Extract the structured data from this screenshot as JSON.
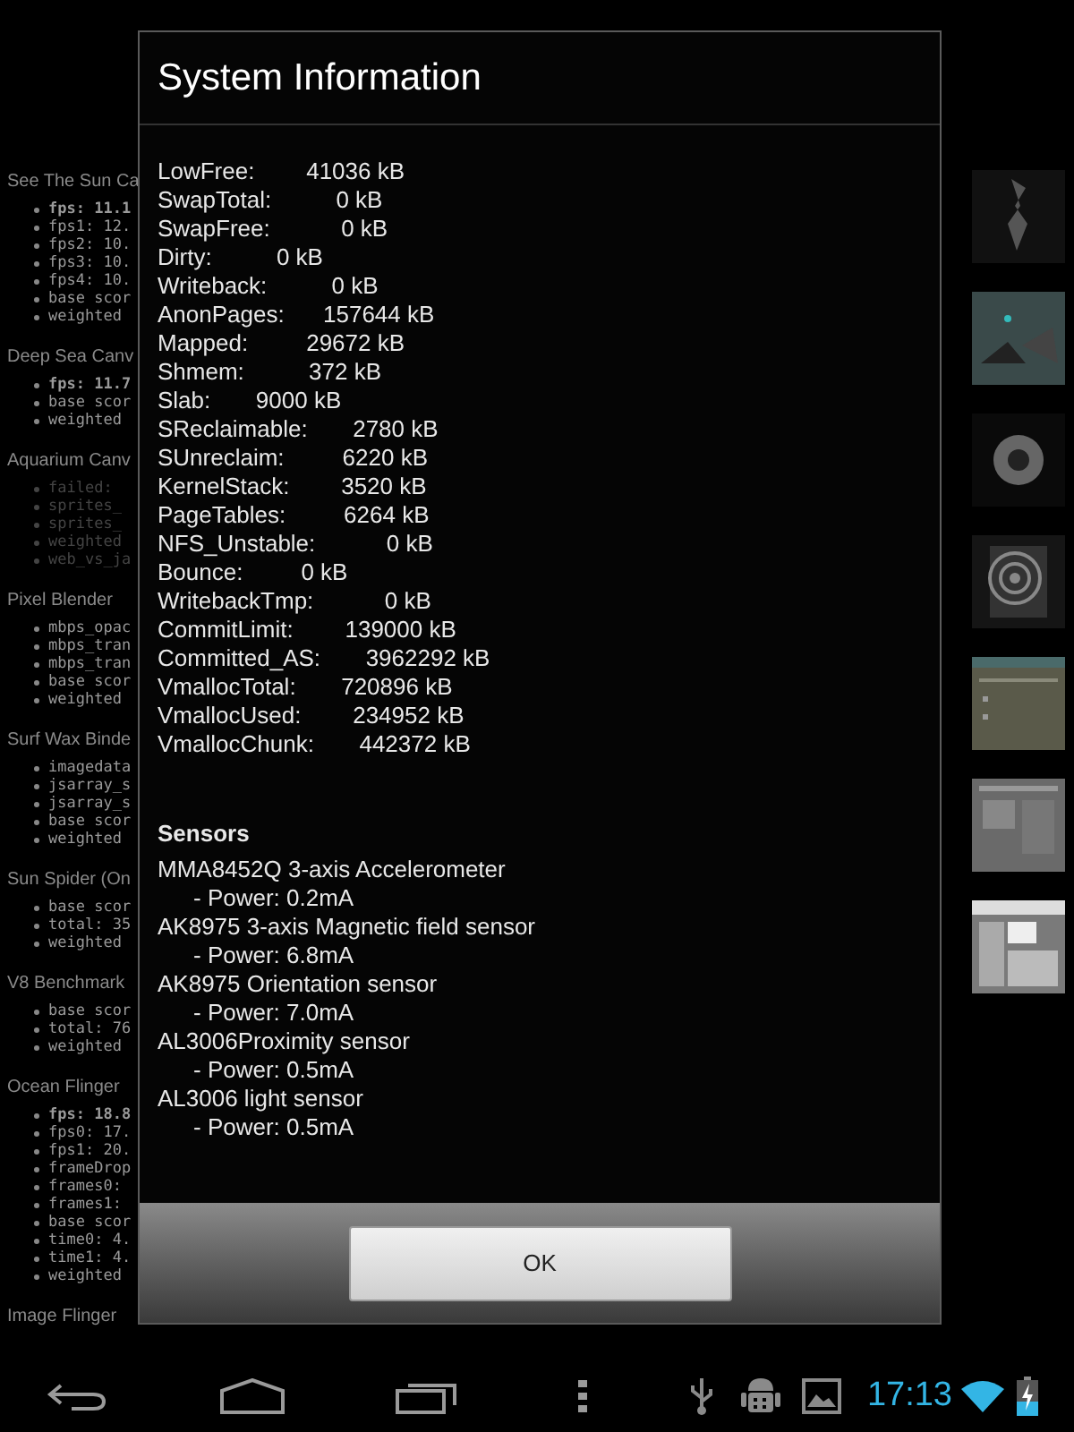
{
  "background": {
    "sections": [
      {
        "title": "See The Sun Ca",
        "items": [
          {
            "text": "fps: 11.1",
            "emphasized": true,
            "disabled": false
          },
          {
            "text": "fps1: 12.",
            "emphasized": false,
            "disabled": false
          },
          {
            "text": "fps2: 10.",
            "emphasized": false,
            "disabled": false
          },
          {
            "text": "fps3: 10.",
            "emphasized": false,
            "disabled": false
          },
          {
            "text": "fps4: 10.",
            "emphasized": false,
            "disabled": false
          },
          {
            "text": "base scor",
            "emphasized": false,
            "disabled": false
          },
          {
            "text": "weighted",
            "emphasized": false,
            "disabled": false
          }
        ]
      },
      {
        "title": "Deep Sea Canv",
        "items": [
          {
            "text": "fps: 11.7",
            "emphasized": true,
            "disabled": false
          },
          {
            "text": "base scor",
            "emphasized": false,
            "disabled": false
          },
          {
            "text": "weighted",
            "emphasized": false,
            "disabled": false
          }
        ]
      },
      {
        "title": "Aquarium Canv",
        "items": [
          {
            "text": "failed:",
            "emphasized": false,
            "disabled": true
          },
          {
            "text": "sprites_",
            "emphasized": false,
            "disabled": true
          },
          {
            "text": "sprites_",
            "emphasized": false,
            "disabled": true
          },
          {
            "text": "weighted",
            "emphasized": false,
            "disabled": true
          },
          {
            "text": "web_vs_ja",
            "emphasized": false,
            "disabled": true
          }
        ]
      },
      {
        "title": "Pixel Blender",
        "items": [
          {
            "text": "mbps_opac",
            "emphasized": false,
            "disabled": false
          },
          {
            "text": "mbps_tran",
            "emphasized": false,
            "disabled": false
          },
          {
            "text": "mbps_tran",
            "emphasized": false,
            "disabled": false
          },
          {
            "text": "base scor",
            "emphasized": false,
            "disabled": false
          },
          {
            "text": "weighted",
            "emphasized": false,
            "disabled": false
          }
        ]
      },
      {
        "title": "Surf Wax Binde",
        "items": [
          {
            "text": "imagedata",
            "emphasized": false,
            "disabled": false
          },
          {
            "text": "jsarray_s",
            "emphasized": false,
            "disabled": false
          },
          {
            "text": "jsarray_s",
            "emphasized": false,
            "disabled": false
          },
          {
            "text": "base scor",
            "emphasized": false,
            "disabled": false
          },
          {
            "text": "weighted",
            "emphasized": false,
            "disabled": false
          }
        ]
      },
      {
        "title": "Sun Spider (On",
        "items": [
          {
            "text": "base scor",
            "emphasized": false,
            "disabled": false
          },
          {
            "text": "total: 35",
            "emphasized": false,
            "disabled": false
          },
          {
            "text": "weighted",
            "emphasized": false,
            "disabled": false
          }
        ]
      },
      {
        "title": "V8 Benchmark",
        "items": [
          {
            "text": "base scor",
            "emphasized": false,
            "disabled": false
          },
          {
            "text": "total: 76",
            "emphasized": false,
            "disabled": false
          },
          {
            "text": "weighted",
            "emphasized": false,
            "disabled": false
          }
        ]
      },
      {
        "title": "Ocean Flinger",
        "items": [
          {
            "text": "fps: 18.8",
            "emphasized": true,
            "disabled": false
          },
          {
            "text": "fps0: 17.",
            "emphasized": false,
            "disabled": false
          },
          {
            "text": "fps1: 20.",
            "emphasized": false,
            "disabled": false
          },
          {
            "text": "frameDrop",
            "emphasized": false,
            "disabled": false
          },
          {
            "text": "frames0:",
            "emphasized": false,
            "disabled": false
          },
          {
            "text": "frames1:",
            "emphasized": false,
            "disabled": false
          },
          {
            "text": "base scor",
            "emphasized": false,
            "disabled": false
          },
          {
            "text": "time0: 4.",
            "emphasized": false,
            "disabled": false
          },
          {
            "text": "time1: 4.",
            "emphasized": false,
            "disabled": false
          },
          {
            "text": "weighted",
            "emphasized": false,
            "disabled": false
          }
        ]
      },
      {
        "title": "Image Flinger"
      }
    ]
  },
  "dialog": {
    "title": "System Information",
    "memory_lines": [
      "LowFree:        41036 kB",
      "SwapTotal:          0 kB",
      "SwapFree:           0 kB",
      "Dirty:          0 kB",
      "Writeback:          0 kB",
      "AnonPages:      157644 kB",
      "Mapped:         29672 kB",
      "Shmem:          372 kB",
      "Slab:       9000 kB",
      "SReclaimable:       2780 kB",
      "SUnreclaim:         6220 kB",
      "KernelStack:        3520 kB",
      "PageTables:         6264 kB",
      "NFS_Unstable:           0 kB",
      "Bounce:         0 kB",
      "WritebackTmp:           0 kB",
      "CommitLimit:        139000 kB",
      "Committed_AS:       3962292 kB",
      "VmallocTotal:       720896 kB",
      "VmallocUsed:        234952 kB",
      "VmallocChunk:       442372 kB"
    ],
    "sensors_heading": "Sensors",
    "sensors": [
      {
        "name": "MMA8452Q 3-axis Accelerometer",
        "power": "- Power: 0.2mA"
      },
      {
        "name": "AK8975 3-axis Magnetic field sensor",
        "power": "- Power: 6.8mA"
      },
      {
        "name": "AK8975 Orientation sensor",
        "power": "- Power: 7.0mA"
      },
      {
        "name": "AL3006Proximity sensor",
        "power": "- Power: 0.5mA"
      },
      {
        "name": "AL3006 light sensor",
        "power": "- Power: 0.5mA"
      }
    ],
    "ok_button": "OK"
  },
  "navigation_bar": {
    "clock": "17:13"
  }
}
